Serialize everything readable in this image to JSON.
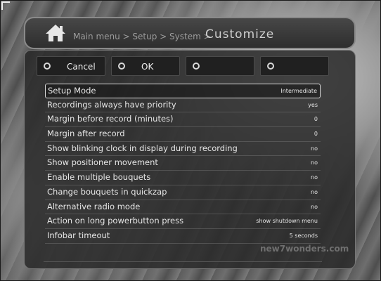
{
  "header": {
    "breadcrumb": "Main menu > Setup > System >",
    "title": "Customize"
  },
  "buttons": [
    {
      "label": "Cancel"
    },
    {
      "label": "OK"
    },
    {
      "label": ""
    },
    {
      "label": ""
    }
  ],
  "settings": [
    {
      "label": "Setup Mode",
      "value": "Intermediate"
    },
    {
      "label": "Recordings always have priority",
      "value": "yes"
    },
    {
      "label": "Margin before record (minutes)",
      "value": "0"
    },
    {
      "label": "Margin after record",
      "value": "0"
    },
    {
      "label": "Show blinking clock in display during recording",
      "value": "no"
    },
    {
      "label": "Show positioner movement",
      "value": "no"
    },
    {
      "label": "Enable multiple bouquets",
      "value": "no"
    },
    {
      "label": "Change bouquets in quickzap",
      "value": "no"
    },
    {
      "label": "Alternative radio mode",
      "value": "no"
    },
    {
      "label": "Action on long powerbutton press",
      "value": "show shutdown menu"
    },
    {
      "label": "Infobar timeout",
      "value": "5 seconds"
    }
  ],
  "watermark": "new7wonders.com"
}
